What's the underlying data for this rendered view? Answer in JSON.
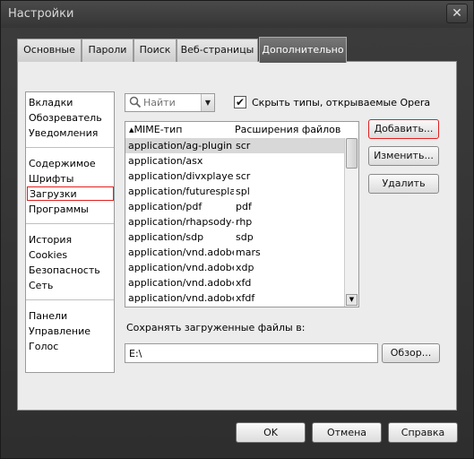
{
  "window": {
    "title": "Настройки",
    "close_glyph": "✕"
  },
  "tabs": [
    {
      "label": "Основные"
    },
    {
      "label": "Пароли"
    },
    {
      "label": "Поиск"
    },
    {
      "label": "Веб-страницы"
    },
    {
      "label": "Дополнительно",
      "active": true
    }
  ],
  "sidebar": {
    "items": [
      "Вкладки",
      "Обозреватель",
      "Уведомления",
      "Содержимое",
      "Шрифты",
      "Загрузки",
      "Программы",
      "История",
      "Cookies",
      "Безопасность",
      "Сеть",
      "Панели",
      "Управление",
      "Голос"
    ],
    "selected": "Загрузки"
  },
  "search": {
    "placeholder": "Найти",
    "icon": "search-icon"
  },
  "hide_types": {
    "checked": true,
    "label": "Скрыть типы, открываемые Opera"
  },
  "table": {
    "columns": [
      "MIME-тип",
      "Расширения файлов"
    ],
    "sort_glyph": "▴",
    "rows": [
      [
        "application/ag-plugin",
        "scr"
      ],
      [
        "application/asx",
        ""
      ],
      [
        "application/divxplayer...",
        "scr"
      ],
      [
        "application/futuresplash",
        "spl"
      ],
      [
        "application/pdf",
        "pdf"
      ],
      [
        "application/rhapsody-...",
        "rhp"
      ],
      [
        "application/sdp",
        "sdp"
      ],
      [
        "application/vnd.adobe....",
        "mars"
      ],
      [
        "application/vnd.adobe....",
        "xdp"
      ],
      [
        "application/vnd.adobe....",
        "xfd"
      ],
      [
        "application/vnd.adobe....",
        "xfdf"
      ]
    ],
    "selected_row": 0
  },
  "actions": {
    "add": "Добавить...",
    "edit": "Изменить...",
    "delete": "Удалить"
  },
  "download": {
    "label": "Сохранять загруженные файлы в:",
    "path": "E:\\",
    "browse": "Обзор..."
  },
  "footer": {
    "ok": "OK",
    "cancel": "Отмена",
    "help": "Справка"
  }
}
